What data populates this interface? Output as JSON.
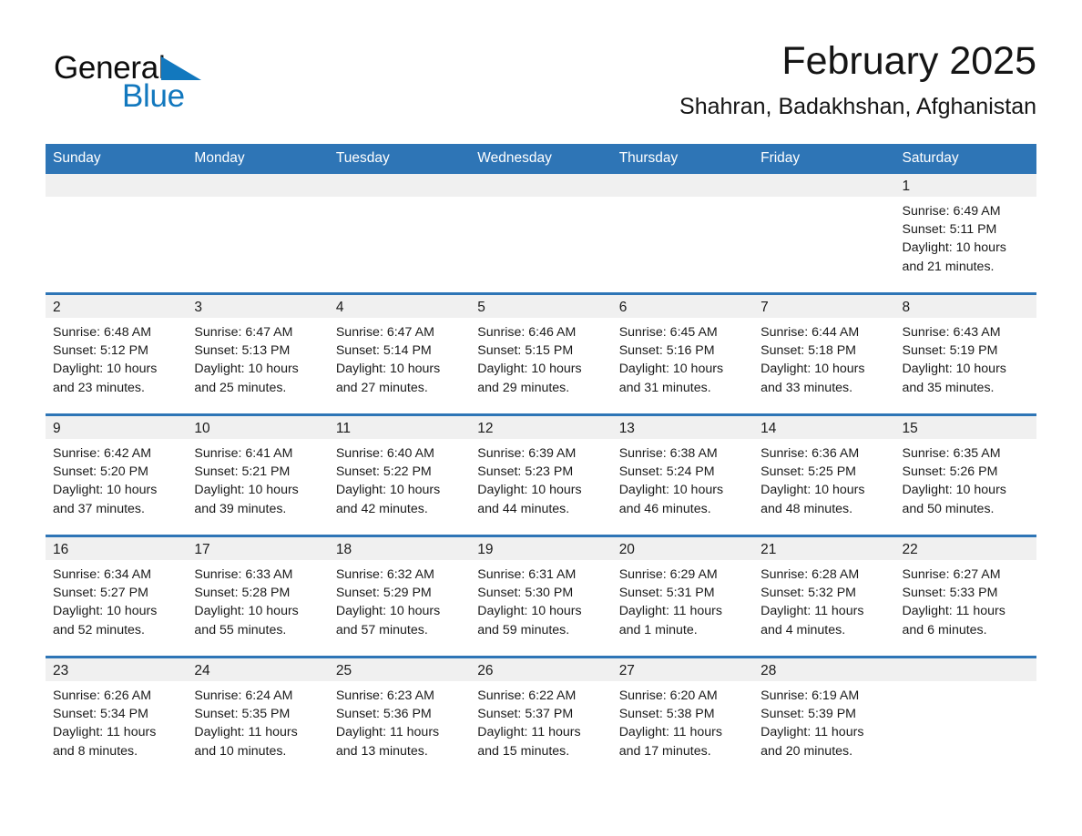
{
  "brand": {
    "name_part1": "General",
    "name_part2": "Blue",
    "accent_color": "#1278be",
    "flag_icon": "triangle-flag-icon"
  },
  "header": {
    "month_title": "February 2025",
    "location": "Shahran, Badakhshan, Afghanistan"
  },
  "calendar": {
    "header_color": "#2e75b6",
    "daynum_band_color": "#f0f0f0",
    "weekday_headers": [
      "Sunday",
      "Monday",
      "Tuesday",
      "Wednesday",
      "Thursday",
      "Friday",
      "Saturday"
    ],
    "weeks": [
      [
        {
          "day": "",
          "lines": []
        },
        {
          "day": "",
          "lines": []
        },
        {
          "day": "",
          "lines": []
        },
        {
          "day": "",
          "lines": []
        },
        {
          "day": "",
          "lines": []
        },
        {
          "day": "",
          "lines": []
        },
        {
          "day": "1",
          "lines": [
            "Sunrise: 6:49 AM",
            "Sunset: 5:11 PM",
            "Daylight: 10 hours",
            "and 21 minutes."
          ]
        }
      ],
      [
        {
          "day": "2",
          "lines": [
            "Sunrise: 6:48 AM",
            "Sunset: 5:12 PM",
            "Daylight: 10 hours",
            "and 23 minutes."
          ]
        },
        {
          "day": "3",
          "lines": [
            "Sunrise: 6:47 AM",
            "Sunset: 5:13 PM",
            "Daylight: 10 hours",
            "and 25 minutes."
          ]
        },
        {
          "day": "4",
          "lines": [
            "Sunrise: 6:47 AM",
            "Sunset: 5:14 PM",
            "Daylight: 10 hours",
            "and 27 minutes."
          ]
        },
        {
          "day": "5",
          "lines": [
            "Sunrise: 6:46 AM",
            "Sunset: 5:15 PM",
            "Daylight: 10 hours",
            "and 29 minutes."
          ]
        },
        {
          "day": "6",
          "lines": [
            "Sunrise: 6:45 AM",
            "Sunset: 5:16 PM",
            "Daylight: 10 hours",
            "and 31 minutes."
          ]
        },
        {
          "day": "7",
          "lines": [
            "Sunrise: 6:44 AM",
            "Sunset: 5:18 PM",
            "Daylight: 10 hours",
            "and 33 minutes."
          ]
        },
        {
          "day": "8",
          "lines": [
            "Sunrise: 6:43 AM",
            "Sunset: 5:19 PM",
            "Daylight: 10 hours",
            "and 35 minutes."
          ]
        }
      ],
      [
        {
          "day": "9",
          "lines": [
            "Sunrise: 6:42 AM",
            "Sunset: 5:20 PM",
            "Daylight: 10 hours",
            "and 37 minutes."
          ]
        },
        {
          "day": "10",
          "lines": [
            "Sunrise: 6:41 AM",
            "Sunset: 5:21 PM",
            "Daylight: 10 hours",
            "and 39 minutes."
          ]
        },
        {
          "day": "11",
          "lines": [
            "Sunrise: 6:40 AM",
            "Sunset: 5:22 PM",
            "Daylight: 10 hours",
            "and 42 minutes."
          ]
        },
        {
          "day": "12",
          "lines": [
            "Sunrise: 6:39 AM",
            "Sunset: 5:23 PM",
            "Daylight: 10 hours",
            "and 44 minutes."
          ]
        },
        {
          "day": "13",
          "lines": [
            "Sunrise: 6:38 AM",
            "Sunset: 5:24 PM",
            "Daylight: 10 hours",
            "and 46 minutes."
          ]
        },
        {
          "day": "14",
          "lines": [
            "Sunrise: 6:36 AM",
            "Sunset: 5:25 PM",
            "Daylight: 10 hours",
            "and 48 minutes."
          ]
        },
        {
          "day": "15",
          "lines": [
            "Sunrise: 6:35 AM",
            "Sunset: 5:26 PM",
            "Daylight: 10 hours",
            "and 50 minutes."
          ]
        }
      ],
      [
        {
          "day": "16",
          "lines": [
            "Sunrise: 6:34 AM",
            "Sunset: 5:27 PM",
            "Daylight: 10 hours",
            "and 52 minutes."
          ]
        },
        {
          "day": "17",
          "lines": [
            "Sunrise: 6:33 AM",
            "Sunset: 5:28 PM",
            "Daylight: 10 hours",
            "and 55 minutes."
          ]
        },
        {
          "day": "18",
          "lines": [
            "Sunrise: 6:32 AM",
            "Sunset: 5:29 PM",
            "Daylight: 10 hours",
            "and 57 minutes."
          ]
        },
        {
          "day": "19",
          "lines": [
            "Sunrise: 6:31 AM",
            "Sunset: 5:30 PM",
            "Daylight: 10 hours",
            "and 59 minutes."
          ]
        },
        {
          "day": "20",
          "lines": [
            "Sunrise: 6:29 AM",
            "Sunset: 5:31 PM",
            "Daylight: 11 hours",
            "and 1 minute."
          ]
        },
        {
          "day": "21",
          "lines": [
            "Sunrise: 6:28 AM",
            "Sunset: 5:32 PM",
            "Daylight: 11 hours",
            "and 4 minutes."
          ]
        },
        {
          "day": "22",
          "lines": [
            "Sunrise: 6:27 AM",
            "Sunset: 5:33 PM",
            "Daylight: 11 hours",
            "and 6 minutes."
          ]
        }
      ],
      [
        {
          "day": "23",
          "lines": [
            "Sunrise: 6:26 AM",
            "Sunset: 5:34 PM",
            "Daylight: 11 hours",
            "and 8 minutes."
          ]
        },
        {
          "day": "24",
          "lines": [
            "Sunrise: 6:24 AM",
            "Sunset: 5:35 PM",
            "Daylight: 11 hours",
            "and 10 minutes."
          ]
        },
        {
          "day": "25",
          "lines": [
            "Sunrise: 6:23 AM",
            "Sunset: 5:36 PM",
            "Daylight: 11 hours",
            "and 13 minutes."
          ]
        },
        {
          "day": "26",
          "lines": [
            "Sunrise: 6:22 AM",
            "Sunset: 5:37 PM",
            "Daylight: 11 hours",
            "and 15 minutes."
          ]
        },
        {
          "day": "27",
          "lines": [
            "Sunrise: 6:20 AM",
            "Sunset: 5:38 PM",
            "Daylight: 11 hours",
            "and 17 minutes."
          ]
        },
        {
          "day": "28",
          "lines": [
            "Sunrise: 6:19 AM",
            "Sunset: 5:39 PM",
            "Daylight: 11 hours",
            "and 20 minutes."
          ]
        },
        {
          "day": "",
          "lines": []
        }
      ]
    ]
  }
}
